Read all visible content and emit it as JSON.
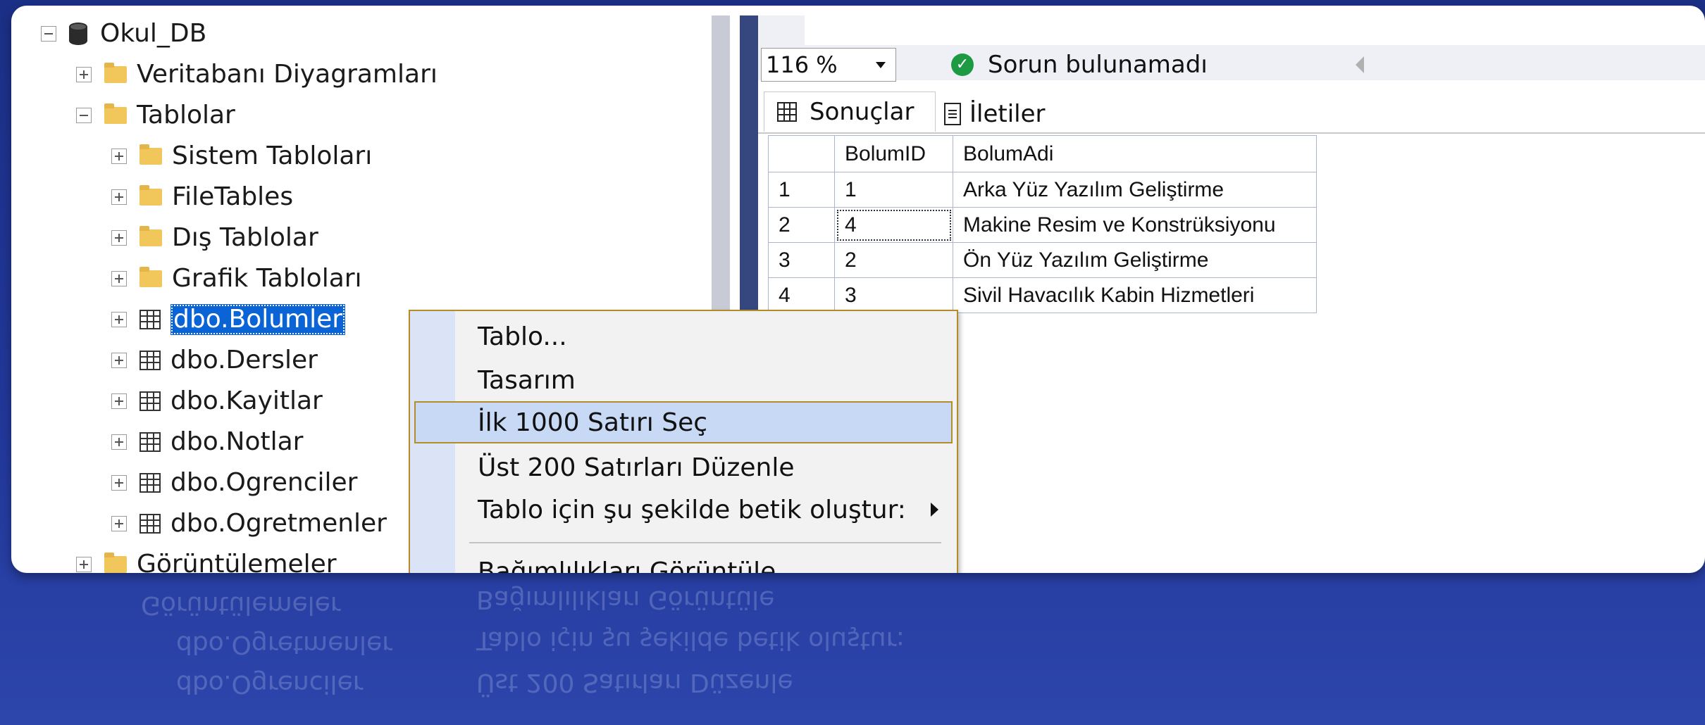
{
  "object_explorer": {
    "database": "Okul_DB",
    "nodes": [
      {
        "label": "Veritabanı Diyagramları"
      },
      {
        "label": "Tablolar"
      },
      {
        "label": "Sistem Tabloları"
      },
      {
        "label": "FileTables"
      },
      {
        "label": "Dış Tablolar"
      },
      {
        "label": "Grafik Tabloları"
      },
      {
        "label": "dbo.Bolumler"
      },
      {
        "label": "dbo.Dersler"
      },
      {
        "label": "dbo.Kayitlar"
      },
      {
        "label": "dbo.Notlar"
      },
      {
        "label": "dbo.Ogrenciler"
      },
      {
        "label": "dbo.Ogretmenler"
      },
      {
        "label": "Görüntülemeler"
      }
    ]
  },
  "query_pane": {
    "zoom": "116 %",
    "status": "Sorun bulunamadı",
    "tabs": {
      "results": "Sonuçlar",
      "messages": "İletiler"
    },
    "table": {
      "columns": [
        "BolumID",
        "BolumAdi"
      ],
      "rows": [
        {
          "n": "1",
          "id": "1",
          "name": "Arka Yüz Yazılım Geliştirme"
        },
        {
          "n": "2",
          "id": "4",
          "name": "Makine Resim ve Konstrüksiyonu"
        },
        {
          "n": "3",
          "id": "2",
          "name": "Ön Yüz Yazılım Geliştirme"
        },
        {
          "n": "4",
          "id": "3",
          "name": "Sivil Havacılık Kabin Hizmetleri"
        }
      ]
    }
  },
  "context_menu": {
    "items": [
      {
        "label": "Tablo..."
      },
      {
        "label": "Tasarım"
      },
      {
        "label": "İlk 1000 Satırı Seç"
      },
      {
        "label": "Üst 200 Satırları Düzenle"
      },
      {
        "label": "Tablo için şu şekilde betik oluştur:"
      },
      {
        "label": "Bağımlılıkları Görüntüle"
      }
    ]
  },
  "colors": {
    "selection": "#0a64d6",
    "menu_border": "#b38d2a",
    "status_ok": "#1f9a44",
    "background": "#1b2f86"
  }
}
